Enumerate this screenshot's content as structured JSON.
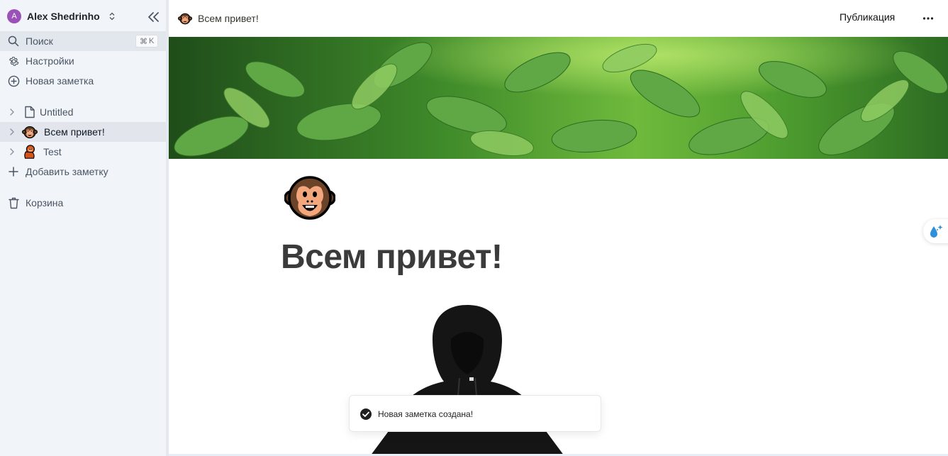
{
  "sidebar": {
    "account": {
      "initial": "A",
      "name": "Alex Shedrinho"
    },
    "nav": {
      "search_label": "Поиск",
      "search_shortcut_symbol": "⌘",
      "search_shortcut_key": "K",
      "settings_label": "Настройки",
      "new_note_label": "Новая заметка"
    },
    "tree": [
      {
        "label": "Untitled",
        "icon": "document-icon"
      },
      {
        "label": "Всем привет!",
        "icon": "monkey-face-icon",
        "active": true
      },
      {
        "label": "Test",
        "icon": "orangutan-icon"
      }
    ],
    "add_note_label": "Добавить заметку",
    "trash_label": "Корзина"
  },
  "topbar": {
    "breadcrumb_title": "Всем привет!",
    "publish_label": "Публикация"
  },
  "page": {
    "title": "Всем привет!",
    "icon": "monkey-face-icon"
  },
  "toast": {
    "message": "Новая заметка создана!"
  },
  "colors": {
    "sidebar_bg": "#f1f5f9",
    "avatar": "#9b51b9",
    "accent_blue": "#2f8fd8"
  }
}
